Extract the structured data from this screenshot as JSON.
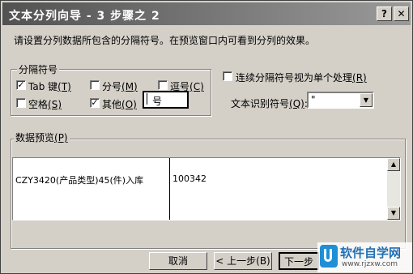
{
  "window": {
    "title": "文本分列向导 - 3 步骤之 2",
    "help_label": "?",
    "close_label": "✕"
  },
  "instruction": "请设置分列数据所包含的分隔符号。在预览窗口内可看到分列的效果。",
  "delimiters": {
    "group_label": "分隔符号",
    "tab": {
      "label": "Tab 键",
      "key": "(T)",
      "checked": true
    },
    "semicolon": {
      "label": "分号",
      "key": "(M)",
      "checked": false
    },
    "comma": {
      "label": "逗号",
      "key": "(C)",
      "checked": false
    },
    "space": {
      "label": "空格",
      "key": "(S)",
      "checked": false
    },
    "other": {
      "label": "其他",
      "key": "(O)",
      "checked": true,
      "value": "号"
    }
  },
  "consecutive": {
    "label": "连续分隔符号视为单个处理",
    "key": "(R)",
    "checked": false
  },
  "qualifier": {
    "label": "文本识别符号",
    "key": "(Q)",
    "value": "\""
  },
  "preview": {
    "group_label": "数据预览",
    "key": "(P)",
    "rows": [
      [
        "CZY3420(产品类型)45(件)入库",
        "100342"
      ]
    ]
  },
  "buttons": {
    "cancel": "取消",
    "back": "< 上一步(B)",
    "next": "下一步"
  },
  "watermark": {
    "brand": "软件自学网",
    "url": "www.rjzxw.com"
  }
}
